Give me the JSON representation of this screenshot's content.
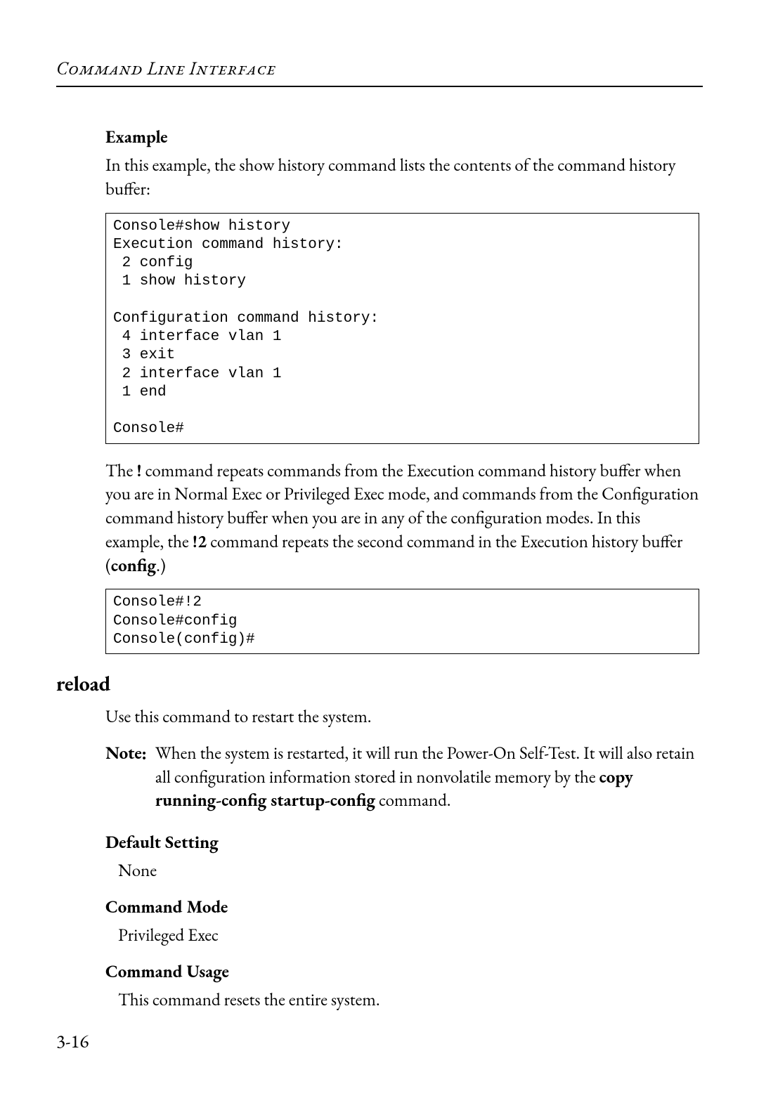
{
  "header": {
    "running_title": "Command Line Interface"
  },
  "s_example": {
    "heading": "Example",
    "intro": "In this example, the show history command lists the contents of the command history buffer:",
    "code": "Console#show history\nExecution command history:\n 2 config\n 1 show history\n\nConfiguration command history:\n 4 interface vlan 1\n 3 exit\n 2 interface vlan 1\n 1 end\n\nConsole#"
  },
  "s_bang": {
    "para_pre": "The ",
    "para_bang": "!",
    "para_mid1": " command repeats commands from the Execution command history buffer when you are in Normal Exec or Privileged Exec mode, and commands from the Configuration command history buffer when you are in any of the configuration modes. In this example, the ",
    "para_bang2": "!2",
    "para_mid2": " command repeats the second command in the Execution history buffer (",
    "para_config": "config",
    "para_post": ".)",
    "code": "Console#!2\nConsole#config\nConsole(config)#"
  },
  "s_reload": {
    "heading": "reload",
    "intro": "Use this command to restart the system.",
    "note_label": "Note:",
    "note_pre": "When the system is restarted, it will run the Power-On Self-Test. It will also retain all configuration information stored in nonvolatile memory by the ",
    "note_bold": "copy running-config startup-config",
    "note_post": " command.",
    "default_setting_h": "Default Setting",
    "default_setting_v": "None",
    "command_mode_h": "Command Mode",
    "command_mode_v": "Privileged Exec",
    "command_usage_h": "Command Usage",
    "command_usage_v": "This command resets the entire system."
  },
  "footer": {
    "page_number": "3-16"
  }
}
